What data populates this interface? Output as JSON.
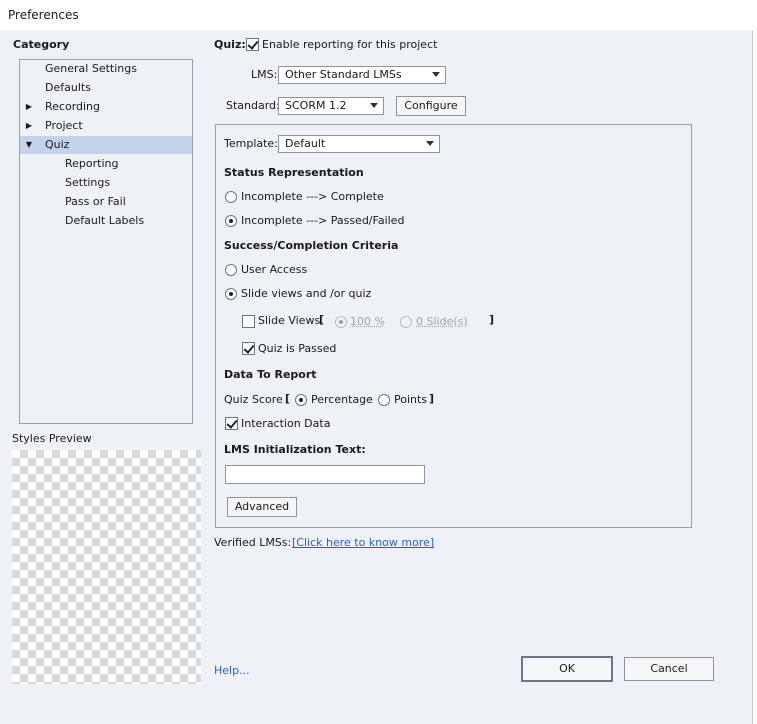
{
  "window": {
    "title": "Preferences"
  },
  "category": {
    "label": "Category",
    "items": [
      {
        "label": "General Settings",
        "level": 0,
        "expander": ""
      },
      {
        "label": "Defaults",
        "level": 0,
        "expander": ""
      },
      {
        "label": "Recording",
        "level": 0,
        "expander": "collapsed"
      },
      {
        "label": "Project",
        "level": 0,
        "expander": "collapsed"
      },
      {
        "label": "Quiz",
        "level": 0,
        "expander": "expanded",
        "selected": true
      },
      {
        "label": "Reporting",
        "level": 1,
        "expander": ""
      },
      {
        "label": "Settings",
        "level": 1,
        "expander": ""
      },
      {
        "label": "Pass or Fail",
        "level": 1,
        "expander": ""
      },
      {
        "label": "Default Labels",
        "level": 1,
        "expander": ""
      }
    ]
  },
  "styles_preview": {
    "label": "Styles Preview"
  },
  "quiz": {
    "label": "Quiz:",
    "enable_reporting": {
      "label": "Enable reporting for this project",
      "checked": true
    },
    "lms": {
      "label": "LMS:",
      "value": "Other Standard LMSs"
    },
    "standard": {
      "label": "Standard:",
      "value": "SCORM 1.2"
    },
    "configure_label": "Configure",
    "template": {
      "label": "Template:",
      "value": "Default"
    },
    "status_representation": {
      "heading": "Status Representation",
      "options": [
        {
          "label": "Incomplete ---> Complete",
          "checked": false
        },
        {
          "label": "Incomplete ---> Passed/Failed",
          "checked": true
        }
      ]
    },
    "success_criteria": {
      "heading": "Success/Completion Criteria",
      "user_access": {
        "label": "User Access",
        "checked": false
      },
      "slide_views_or_quiz": {
        "label": "Slide views and /or quiz",
        "checked": true
      },
      "slide_views": {
        "label": "Slide Views",
        "checked": false,
        "open_bracket": "[",
        "close_bracket": "]",
        "percent_option": {
          "label": "100 %",
          "checked": true
        },
        "slides_option": {
          "label": "0 Slide(s)",
          "checked": false
        }
      },
      "quiz_is_passed": {
        "label": "Quiz is Passed",
        "checked": true
      }
    },
    "data_to_report": {
      "heading": "Data To Report",
      "quiz_score_label": "Quiz Score",
      "open_bracket": "[",
      "close_bracket": "]",
      "percentage": {
        "label": "Percentage",
        "checked": true
      },
      "points": {
        "label": "Points",
        "checked": false
      },
      "interaction_data": {
        "label": "Interaction Data",
        "checked": true
      }
    },
    "lms_init": {
      "heading": "LMS Initialization Text:",
      "value": ""
    },
    "advanced_label": "Advanced",
    "verified_lms": {
      "label": "Verified LMSs:",
      "link": "[Click here to know more]"
    }
  },
  "footer": {
    "help": "Help...",
    "ok": "OK",
    "cancel": "Cancel"
  }
}
